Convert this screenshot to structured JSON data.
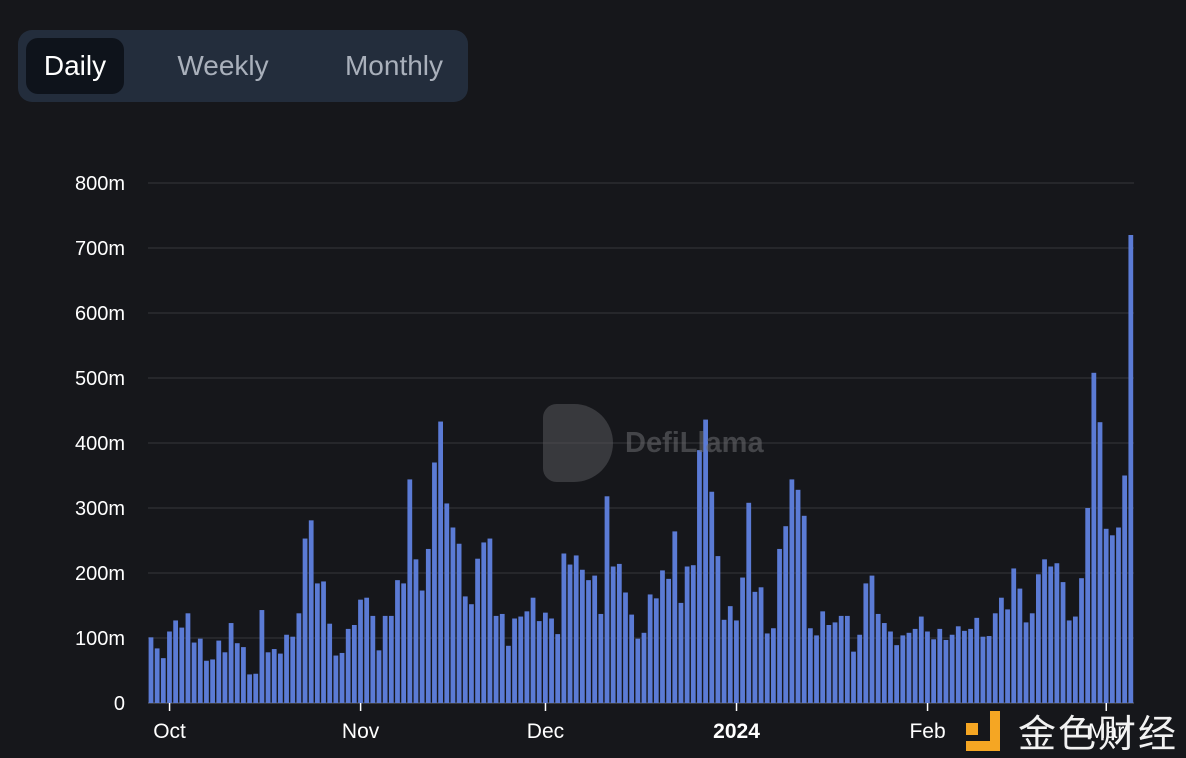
{
  "tabs": [
    {
      "label": "Daily",
      "active": true
    },
    {
      "label": "Weekly",
      "active": false
    },
    {
      "label": "Monthly",
      "active": false
    }
  ],
  "watermark": {
    "text": "DefiLlama"
  },
  "source_logo": {
    "text": "金色财经"
  },
  "colors": {
    "background": "#16171b",
    "bar": "#5b7bd5",
    "grid": "#2c2d31",
    "tab_bg": "#232d3c",
    "tab_active": "#0e131b"
  },
  "chart_data": {
    "type": "bar",
    "title": "",
    "xlabel": "",
    "ylabel": "",
    "ylim": [
      0,
      800000000
    ],
    "grid": true,
    "y_ticks": [
      {
        "value": 0,
        "label": "0"
      },
      {
        "value": 100000000,
        "label": "100m"
      },
      {
        "value": 200000000,
        "label": "200m"
      },
      {
        "value": 300000000,
        "label": "300m"
      },
      {
        "value": 400000000,
        "label": "400m"
      },
      {
        "value": 500000000,
        "label": "500m"
      },
      {
        "value": 600000000,
        "label": "600m"
      },
      {
        "value": 700000000,
        "label": "700m"
      },
      {
        "value": 800000000,
        "label": "800m"
      }
    ],
    "x_ticks": [
      {
        "date": "2023-10-01",
        "label": "Oct",
        "bold": false
      },
      {
        "date": "2023-11-01",
        "label": "Nov",
        "bold": false
      },
      {
        "date": "2023-12-01",
        "label": "Dec",
        "bold": false
      },
      {
        "date": "2024-01-01",
        "label": "2024",
        "bold": true
      },
      {
        "date": "2024-02-01",
        "label": "Feb",
        "bold": false
      },
      {
        "date": "2024-03-01",
        "label": "Mar",
        "bold": false
      }
    ],
    "x": [
      "2023-09-28",
      "2023-09-29",
      "2023-09-30",
      "2023-10-01",
      "2023-10-02",
      "2023-10-03",
      "2023-10-04",
      "2023-10-05",
      "2023-10-06",
      "2023-10-07",
      "2023-10-08",
      "2023-10-09",
      "2023-10-10",
      "2023-10-11",
      "2023-10-12",
      "2023-10-13",
      "2023-10-14",
      "2023-10-15",
      "2023-10-16",
      "2023-10-17",
      "2023-10-18",
      "2023-10-19",
      "2023-10-20",
      "2023-10-21",
      "2023-10-22",
      "2023-10-23",
      "2023-10-24",
      "2023-10-25",
      "2023-10-26",
      "2023-10-27",
      "2023-10-28",
      "2023-10-29",
      "2023-10-30",
      "2023-10-31",
      "2023-11-01",
      "2023-11-02",
      "2023-11-03",
      "2023-11-04",
      "2023-11-05",
      "2023-11-06",
      "2023-11-07",
      "2023-11-08",
      "2023-11-09",
      "2023-11-10",
      "2023-11-11",
      "2023-11-12",
      "2023-11-13",
      "2023-11-14",
      "2023-11-15",
      "2023-11-16",
      "2023-11-17",
      "2023-11-18",
      "2023-11-19",
      "2023-11-20",
      "2023-11-21",
      "2023-11-22",
      "2023-11-23",
      "2023-11-24",
      "2023-11-25",
      "2023-11-26",
      "2023-11-27",
      "2023-11-28",
      "2023-11-29",
      "2023-11-30",
      "2023-12-01",
      "2023-12-02",
      "2023-12-03",
      "2023-12-04",
      "2023-12-05",
      "2023-12-06",
      "2023-12-07",
      "2023-12-08",
      "2023-12-09",
      "2023-12-10",
      "2023-12-11",
      "2023-12-12",
      "2023-12-13",
      "2023-12-14",
      "2023-12-15",
      "2023-12-16",
      "2023-12-17",
      "2023-12-18",
      "2023-12-19",
      "2023-12-20",
      "2023-12-21",
      "2023-12-22",
      "2023-12-23",
      "2023-12-24",
      "2023-12-25",
      "2023-12-26",
      "2023-12-27",
      "2023-12-28",
      "2023-12-29",
      "2023-12-30",
      "2023-12-31",
      "2024-01-01",
      "2024-01-02",
      "2024-01-03",
      "2024-01-04",
      "2024-01-05",
      "2024-01-06",
      "2024-01-07",
      "2024-01-08",
      "2024-01-09",
      "2024-01-10",
      "2024-01-11",
      "2024-01-12",
      "2024-01-13",
      "2024-01-14",
      "2024-01-15",
      "2024-01-16",
      "2024-01-17",
      "2024-01-18",
      "2024-01-19",
      "2024-01-20",
      "2024-01-21",
      "2024-01-22",
      "2024-01-23",
      "2024-01-24",
      "2024-01-25",
      "2024-01-26",
      "2024-01-27",
      "2024-01-28",
      "2024-01-29",
      "2024-01-30",
      "2024-01-31",
      "2024-02-01",
      "2024-02-02",
      "2024-02-03",
      "2024-02-04",
      "2024-02-05",
      "2024-02-06",
      "2024-02-07",
      "2024-02-08",
      "2024-02-09",
      "2024-02-10",
      "2024-02-11",
      "2024-02-12",
      "2024-02-13",
      "2024-02-14",
      "2024-02-15",
      "2024-02-16",
      "2024-02-17",
      "2024-02-18",
      "2024-02-19",
      "2024-02-20",
      "2024-02-21",
      "2024-02-22",
      "2024-02-23",
      "2024-02-24",
      "2024-02-25",
      "2024-02-26",
      "2024-02-27",
      "2024-02-28",
      "2024-02-29",
      "2024-03-01",
      "2024-03-02",
      "2024-03-03",
      "2024-03-04",
      "2024-03-05"
    ],
    "values_m": [
      101,
      84,
      69,
      110,
      127,
      116,
      138,
      93,
      99,
      65,
      67,
      96,
      78,
      123,
      92,
      86,
      44,
      45,
      143,
      78,
      83,
      76,
      105,
      102,
      138,
      253,
      281,
      184,
      187,
      122,
      73,
      77,
      114,
      120,
      159,
      162,
      134,
      81,
      134,
      134,
      189,
      184,
      344,
      221,
      173,
      237,
      370,
      433,
      307,
      270,
      245,
      164,
      152,
      222,
      247,
      253,
      134,
      137,
      88,
      130,
      133,
      141,
      162,
      126,
      139,
      130,
      106,
      230,
      213,
      227,
      205,
      189,
      196,
      137,
      318,
      210,
      214,
      170,
      136,
      99,
      108,
      167,
      161,
      204,
      191,
      264,
      154,
      210,
      212,
      389,
      436,
      325,
      226,
      128,
      149,
      127,
      193,
      308,
      171,
      178,
      107,
      115,
      237,
      272,
      344,
      328,
      288,
      115,
      104,
      141,
      120,
      124,
      134,
      134,
      79,
      105,
      184,
      196,
      137,
      123,
      110,
      89,
      104,
      108,
      114,
      133,
      110,
      98,
      114,
      97,
      105,
      118,
      111,
      114,
      131,
      102,
      103,
      138,
      162,
      144,
      207,
      176,
      124,
      138,
      198,
      221,
      210,
      215,
      186,
      127,
      133,
      192,
      300,
      508,
      432,
      268,
      258,
      270,
      350,
      720
    ],
    "value_unit": "millions"
  }
}
